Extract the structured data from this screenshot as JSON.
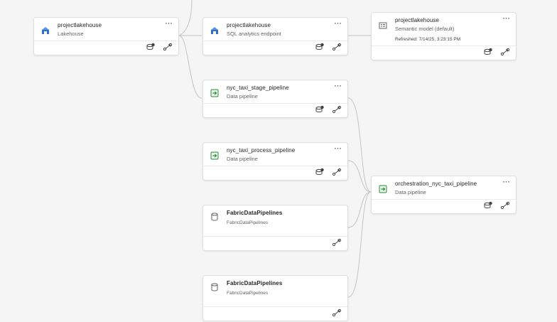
{
  "colors": {
    "background": "#f5f5f5",
    "card": "#ffffff",
    "connector": "#c4c4c4",
    "lakehouse_icon": "#2f6fce",
    "pipeline_icon": "#2e8b3a"
  },
  "nodes": {
    "lakehouse": {
      "title": "projectlakehouse",
      "subtitle": "Lakehouse",
      "icon": "lakehouse-icon",
      "more": "···"
    },
    "sql_endpoint": {
      "title": "projectlakehouse",
      "subtitle": "SQL analytics endpoint",
      "icon": "sql-endpoint-icon",
      "more": "···"
    },
    "semantic_model": {
      "title": "projectlakehouse",
      "subtitle": "Semantic model (default)",
      "refreshed": "Refreshed: 7/14/25, 3:23:15 PM",
      "icon": "semantic-model-icon",
      "more": "···"
    },
    "stage_pipeline": {
      "title": "nyc_taxi_stage_pipeline",
      "subtitle": "Data pipeline",
      "icon": "pipeline-icon",
      "more": "···"
    },
    "process_pipeline": {
      "title": "nyc_taxi_process_pipeline",
      "subtitle": "Data pipeline",
      "icon": "pipeline-icon",
      "more": "···"
    },
    "orchestration_pipeline": {
      "title": "orchestration_nyc_taxi_pipeline",
      "subtitle": "Data pipeline",
      "icon": "pipeline-icon",
      "more": "···"
    },
    "fabric_1": {
      "title": "FabricDataPipelines",
      "subtitle": "FabricDataPipelines",
      "icon": "database-icon"
    },
    "fabric_2": {
      "title": "FabricDataPipelines",
      "subtitle": "FabricDataPipelines",
      "icon": "database-icon"
    }
  },
  "actions": {
    "impact": "impact-analysis-icon",
    "lineage": "lineage-icon"
  }
}
